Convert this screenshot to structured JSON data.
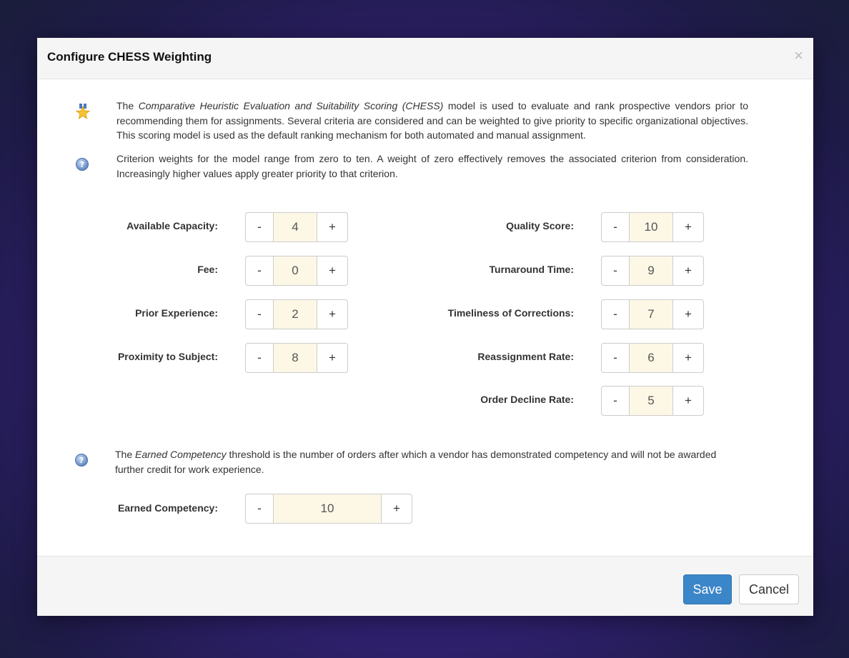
{
  "modal": {
    "title": "Configure CHESS Weighting",
    "close_glyph": "×"
  },
  "intro": {
    "part1": "The ",
    "em": "Comparative Heuristic Evaluation and Suitability Scoring (CHESS)",
    "part2": " model is used to evaluate and rank prospective vendors prior to recommending them for assignments. Several criteria are considered and can be weighted to give priority to specific organizational objectives. This scoring model is used as the default ranking mechanism for both automated and manual assignment."
  },
  "info": {
    "text": "Criterion weights for the model range from zero to ten. A weight of zero effectively removes the associated criterion from consideration. Increasingly higher values apply greater priority to that criterion."
  },
  "stepper": {
    "minus": "-",
    "plus": "+"
  },
  "criteria_left": [
    {
      "label": "Available Capacity:",
      "value": "4"
    },
    {
      "label": "Fee:",
      "value": "0"
    },
    {
      "label": "Prior Experience:",
      "value": "2"
    },
    {
      "label": "Proximity to Subject:",
      "value": "8"
    }
  ],
  "criteria_right": [
    {
      "label": "Quality Score:",
      "value": "10"
    },
    {
      "label": "Turnaround Time:",
      "value": "9"
    },
    {
      "label": "Timeliness of Corrections:",
      "value": "7"
    },
    {
      "label": "Reassignment Rate:",
      "value": "6"
    },
    {
      "label": "Order Decline Rate:",
      "value": "5"
    }
  ],
  "competency": {
    "part1": "The ",
    "em": "Earned Competency",
    "part2": " threshold is the number of orders after which a vendor has demonstrated competency and will not be awarded further credit for work experience.",
    "label": "Earned Competency:",
    "value": "10"
  },
  "footer": {
    "save": "Save",
    "cancel": "Cancel"
  },
  "icons": {
    "intro": "star-medal-icon",
    "info": "help-icon"
  },
  "colors": {
    "accent": "#3b86c8",
    "value_bg": "#fdf8e6"
  }
}
